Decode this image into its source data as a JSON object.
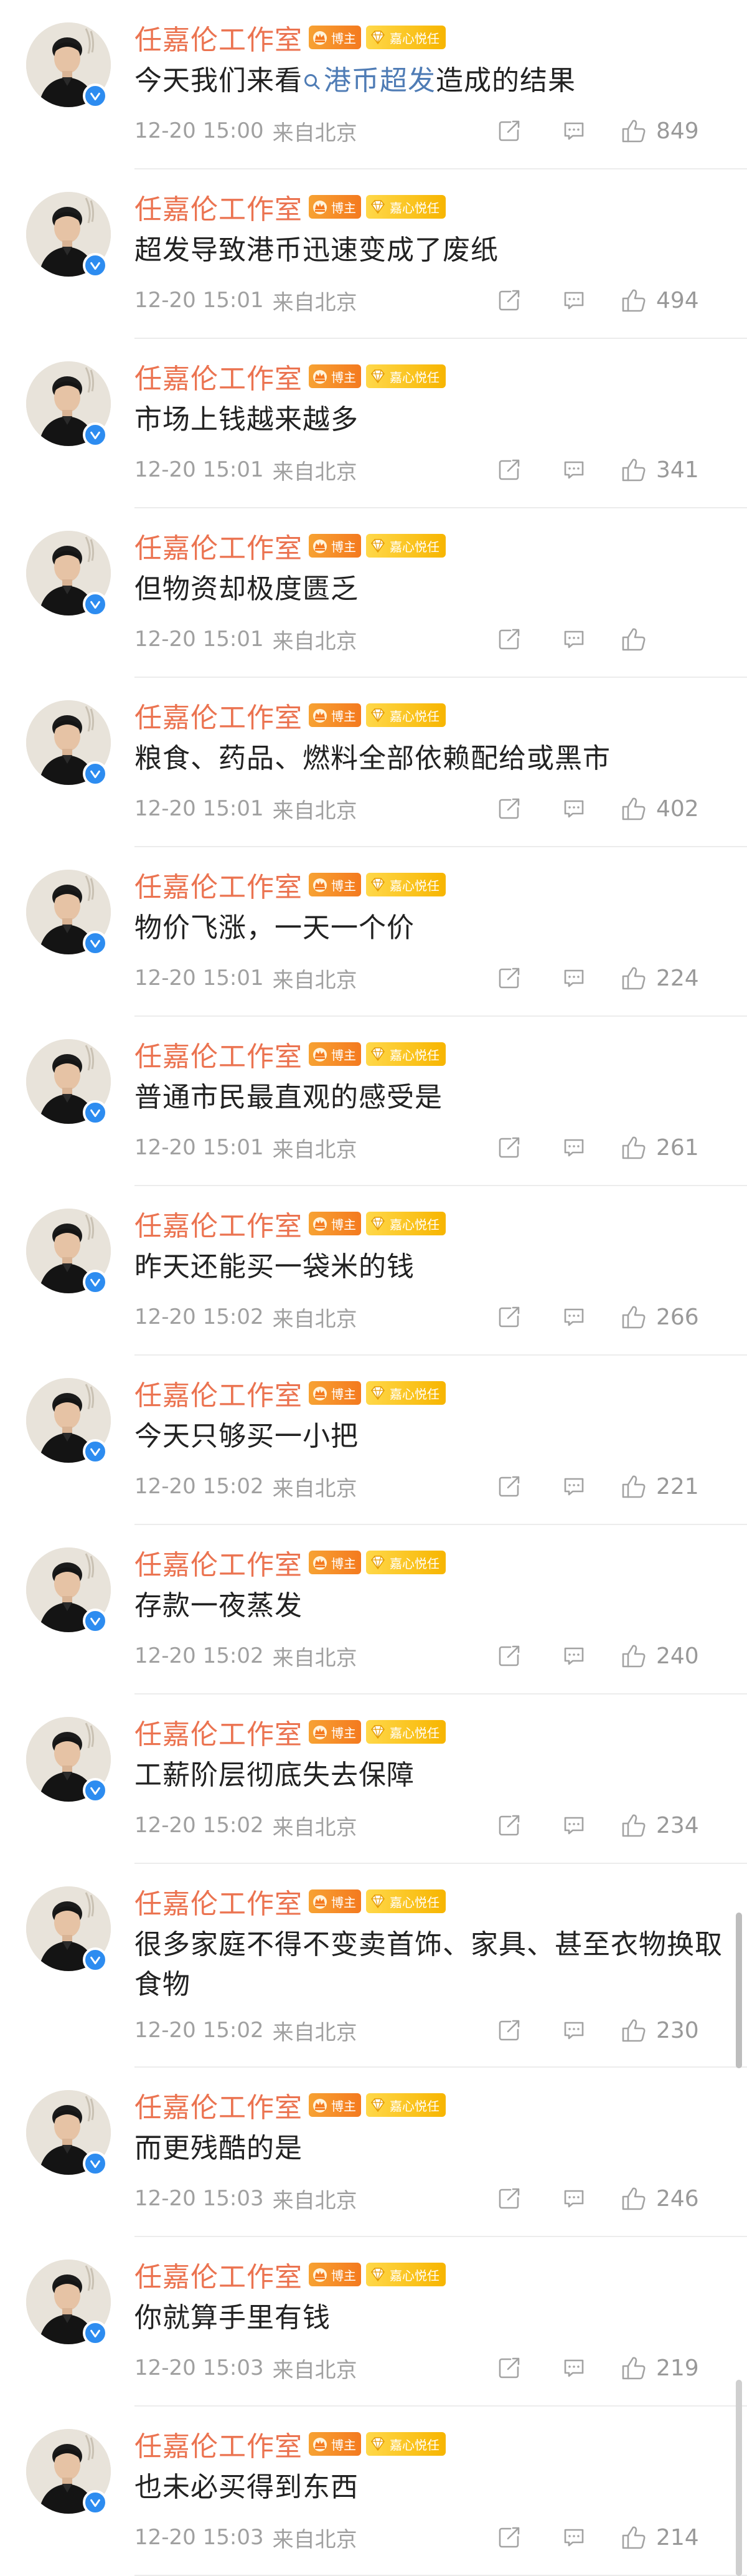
{
  "user": {
    "name": "任嘉伦工作室",
    "badge_host": "博主",
    "badge_fan": "嘉心悦任"
  },
  "comments": [
    {
      "before": "今天我们来看",
      "topic": "港币超发",
      "after": "造成的结果",
      "time": "12-20 15:00",
      "source": "来自北京",
      "likes": "849"
    },
    {
      "text": "超发导致港币迅速变成了废纸",
      "time": "12-20 15:01",
      "source": "来自北京",
      "likes": "494"
    },
    {
      "text": "市场上钱越来越多",
      "time": "12-20 15:01",
      "source": "来自北京",
      "likes": "341"
    },
    {
      "text": "但物资却极度匮乏",
      "time": "12-20 15:01",
      "source": "来自北京",
      "likes": ""
    },
    {
      "text": "粮食、药品、燃料全部依赖配给或黑市",
      "time": "12-20 15:01",
      "source": "来自北京",
      "likes": "402"
    },
    {
      "text": "物价飞涨，一天一个价",
      "time": "12-20 15:01",
      "source": "来自北京",
      "likes": "224"
    },
    {
      "text": "普通市民最直观的感受是",
      "time": "12-20 15:01",
      "source": "来自北京",
      "likes": "261"
    },
    {
      "text": "昨天还能买一袋米的钱",
      "time": "12-20 15:02",
      "source": "来自北京",
      "likes": "266"
    },
    {
      "text": "今天只够买一小把",
      "time": "12-20 15:02",
      "source": "来自北京",
      "likes": "221"
    },
    {
      "text": "存款一夜蒸发",
      "time": "12-20 15:02",
      "source": "来自北京",
      "likes": "240"
    },
    {
      "text": "工薪阶层彻底失去保障",
      "time": "12-20 15:02",
      "source": "来自北京",
      "likes": "234"
    },
    {
      "text": "很多家庭不得不变卖首饰、家具、甚至衣物换取食物",
      "time": "12-20 15:02",
      "source": "来自北京",
      "likes": "230"
    },
    {
      "text": "而更残酷的是",
      "time": "12-20 15:03",
      "source": "来自北京",
      "likes": "246"
    },
    {
      "text": "你就算手里有钱",
      "time": "12-20 15:03",
      "source": "来自北京",
      "likes": "219"
    },
    {
      "text": "也未必买得到东西",
      "time": "12-20 15:03",
      "source": "来自北京",
      "likes": "214"
    }
  ],
  "colors": {
    "username": "#eb7350",
    "topic": "#4f7cb5",
    "meta": "#a0a0a0",
    "verified": "#2d8cf0"
  }
}
